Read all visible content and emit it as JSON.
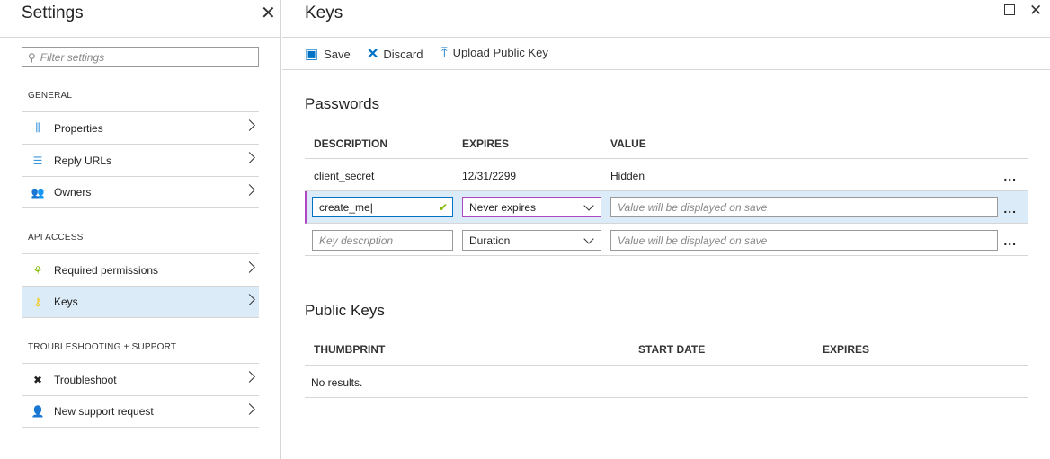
{
  "settings": {
    "title": "Settings",
    "filter_placeholder": "Filter settings",
    "sections": [
      {
        "label": "GENERAL",
        "items": [
          "Properties",
          "Reply URLs",
          "Owners"
        ]
      },
      {
        "label": "API ACCESS",
        "items": [
          "Required permissions",
          "Keys"
        ]
      },
      {
        "label": "TROUBLESHOOTING + SUPPORT",
        "items": [
          "Troubleshoot",
          "New support request"
        ]
      }
    ],
    "selected": "Keys"
  },
  "keys": {
    "title": "Keys",
    "toolbar": {
      "save": "Save",
      "discard": "Discard",
      "upload": "Upload Public Key"
    },
    "passwords": {
      "title": "Passwords",
      "headers": [
        "DESCRIPTION",
        "EXPIRES",
        "VALUE"
      ],
      "row1": {
        "description": "client_secret",
        "expires": "12/31/2299",
        "value": "Hidden"
      },
      "row2": {
        "description": "create_me",
        "expires": "Never expires",
        "value_placeholder": "Value will be displayed on save"
      },
      "row3": {
        "description_placeholder": "Key description",
        "expires": "Duration",
        "value_placeholder": "Value will be displayed on save"
      },
      "more": "..."
    },
    "public_keys": {
      "title": "Public Keys",
      "headers": [
        "THUMBPRINT",
        "START DATE",
        "EXPIRES"
      ],
      "empty": "No results."
    }
  },
  "colors": {
    "accent": "#0072c6",
    "selected_bg": "#dcebf8",
    "active_border": "#b146c2",
    "check": "#7fba00"
  }
}
